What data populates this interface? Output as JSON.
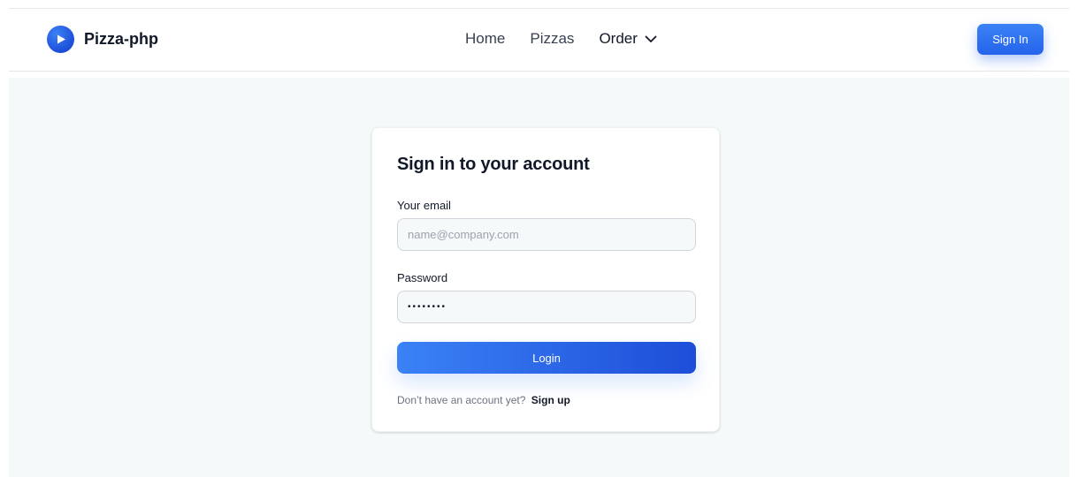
{
  "brand": {
    "name": "Pizza-php",
    "logo_icon": "play-circle-icon",
    "color": "#1d4ed8"
  },
  "nav": {
    "links": [
      "Home",
      "Pizzas"
    ],
    "order_label": "Order",
    "order_icon": "chevron-down-icon"
  },
  "header": {
    "signin_label": "Sign In"
  },
  "form": {
    "title": "Sign in to your account",
    "email_label": "Your email",
    "email_placeholder": "name@company.com",
    "password_label": "Password",
    "password_value": "••••••••",
    "login_label": "Login",
    "signup_prompt": "Don’t have an account yet?",
    "signup_link": "Sign up"
  },
  "colors": {
    "accent": "#2563eb",
    "accent_light": "#3b82f6",
    "page_bg": "#f5f9f9"
  }
}
